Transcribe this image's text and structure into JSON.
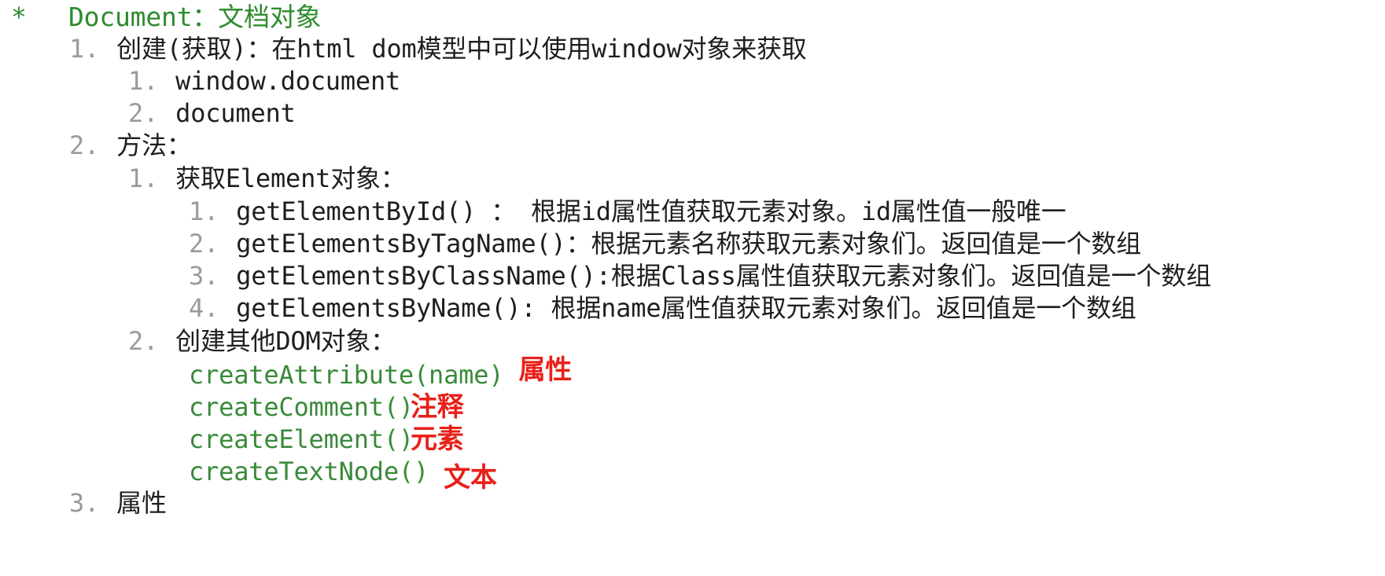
{
  "header": {
    "bullet": "*",
    "title": "Document：文档对象"
  },
  "items": {
    "create": {
      "num": "1.",
      "label": "创建(获取)：在html dom模型中可以使用window对象来获取",
      "sub": [
        {
          "num": "1.",
          "text": "window.document"
        },
        {
          "num": "2.",
          "text": "document"
        }
      ]
    },
    "methods": {
      "num": "2.",
      "label": "方法：",
      "get_element": {
        "num": "1.",
        "label": "获取Element对象：",
        "sub": [
          {
            "num": "1.",
            "text": "getElementById()  ： 根据id属性值获取元素对象。id属性值一般唯一"
          },
          {
            "num": "2.",
            "text": "getElementsByTagName()：根据元素名称获取元素对象们。返回值是一个数组"
          },
          {
            "num": "3.",
            "text": "getElementsByClassName():根据Class属性值获取元素对象们。返回值是一个数组"
          },
          {
            "num": "4.",
            "text": "getElementsByName(): 根据name属性值获取元素对象们。返回值是一个数组"
          }
        ]
      },
      "create_dom": {
        "num": "2.",
        "label": "创建其他DOM对象：",
        "sub": [
          {
            "code": "createAttribute(name)",
            "note": "属性"
          },
          {
            "code": "createComment()",
            "note": "注释"
          },
          {
            "code": "createElement()",
            "note": "元素"
          },
          {
            "code": "createTextNode()",
            "note": "文本"
          }
        ]
      }
    },
    "properties": {
      "num": "3.",
      "label": "属性"
    }
  },
  "colors": {
    "header_green": "#2e8b2e",
    "code_green": "#3a8a3a",
    "annotation_red": "#e8201a",
    "number_gray": "#9a9a9a",
    "text": "#1e1e1e"
  }
}
